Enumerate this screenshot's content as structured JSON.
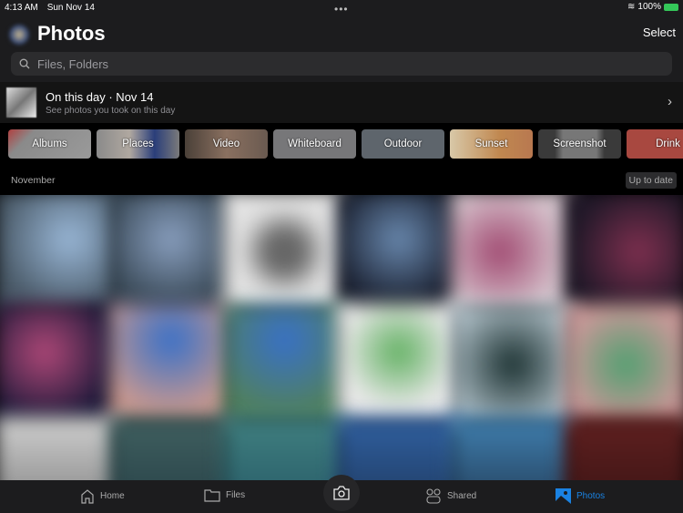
{
  "status": {
    "time": "4:13 AM",
    "date": "Sun Nov 14",
    "battery": "100%"
  },
  "header": {
    "title": "Photos",
    "select_label": "Select",
    "search_placeholder": "Files, Folders"
  },
  "on_this_day": {
    "title": "On this day · Nov 14",
    "subtitle": "See photos you took on this day"
  },
  "categories": [
    {
      "label": "Albums",
      "bg": "linear-gradient(135deg,#b04040 0,#8a8a8a 25%,#9a9a9a)"
    },
    {
      "label": "Places",
      "bg": "linear-gradient(90deg,#8a8a8a,#b0a8a0 40%,#2a3e7a 70%,#7a7a7a)"
    },
    {
      "label": "Video",
      "bg": "linear-gradient(90deg,#4a4038,#8a7060 50%,#6a5a50)"
    },
    {
      "label": "Whiteboard",
      "bg": "#777779"
    },
    {
      "label": "Outdoor",
      "bg": "#5e656c"
    },
    {
      "label": "Sunset",
      "bg": "linear-gradient(90deg,#d8c8a8,#c08850 60%,#b87850)"
    },
    {
      "label": "Screenshot",
      "bg": "linear-gradient(90deg,#3a3a3a 20%,#777 30%,#777 70%,#3a3a3a 80%)"
    },
    {
      "label": "Drink",
      "bg": "#a84840"
    }
  ],
  "section": {
    "month": "November",
    "status": "Up to date"
  },
  "photos": [
    "radial-gradient(circle at 60% 40%,#9ab8d8,#4a5a68 70%)",
    "radial-gradient(circle at 50% 40%,#8aa0c0,#3a4a58 70%)",
    "radial-gradient(circle,#666 20%,#ddd 50%,#eee)",
    "radial-gradient(circle at 50% 40%,#6a8ab0,#1a2030 70%)",
    "radial-gradient(circle at 40% 50%,#a04870,#d8c8d0 70%)",
    "radial-gradient(circle at 60% 50%,#803050,#201828 70%)",
    "radial-gradient(circle at 40% 40%,#b04878,#1a1838 70%)",
    "radial-gradient(circle at 50% 30%,#3870c8,#c89890 70%)",
    "radial-gradient(circle at 50% 30%,#3870c8,#508060 70%)",
    "radial-gradient(circle at 50% 40%,#60b060,#e8e8e8 60%)",
    "radial-gradient(circle at 50% 50%,#1a3030,#b0c0c8 80%)",
    "radial-gradient(circle at 50% 50%,#50a070,#c89898 70%)",
    "linear-gradient(#d0d0d0,#707070)",
    "linear-gradient(#406060,#203840)",
    "linear-gradient(#408080,#205060)",
    "linear-gradient(#3060a0,#1a3050)",
    "linear-gradient(#4080b0,#1a2a40)",
    "linear-gradient(#602020,#301010)"
  ],
  "tabs": [
    {
      "label": "Home"
    },
    {
      "label": "Files"
    },
    {
      "label": "Shared"
    },
    {
      "label": "Photos",
      "active": true
    }
  ],
  "colors": {
    "accent": "#1a82e2",
    "battery": "#34c759"
  }
}
